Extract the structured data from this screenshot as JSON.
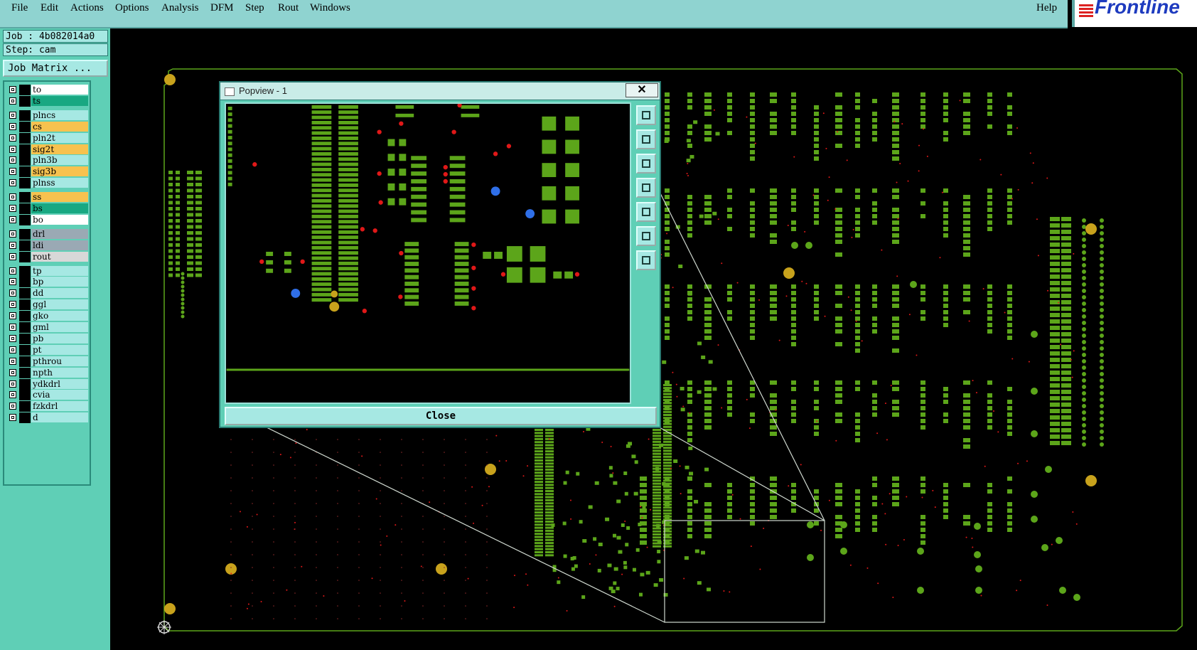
{
  "menu": {
    "items": [
      "File",
      "Edit",
      "Actions",
      "Options",
      "Analysis",
      "DFM",
      "Step",
      "Rout",
      "Windows"
    ],
    "help": "Help"
  },
  "logo": {
    "text": "Frontline"
  },
  "job": {
    "job_line": "Job : 4b082014a0",
    "step_line": "Step: cam",
    "matrix_button": "Job Matrix ..."
  },
  "layers": [
    {
      "name": "to",
      "color": "#ffffff"
    },
    {
      "name": "ts",
      "color": "#18a882"
    },
    {
      "name": "plncs",
      "color": "#a6e8e3"
    },
    {
      "name": "cs",
      "color": "#f7c24f"
    },
    {
      "name": "pln2t",
      "color": "#a6e8e3"
    },
    {
      "name": "sig2t",
      "color": "#f7c24f"
    },
    {
      "name": "pln3b",
      "color": "#a6e8e3"
    },
    {
      "name": "sig3b",
      "color": "#f7c24f"
    },
    {
      "name": "plnss",
      "color": "#a6e8e3"
    },
    {
      "name": "ss",
      "color": "#f7c24f"
    },
    {
      "name": "bs",
      "color": "#18a882"
    },
    {
      "name": "bo",
      "color": "#ffffff"
    },
    {
      "name": "drl",
      "color": "#9aa9b4"
    },
    {
      "name": "ldi",
      "color": "#9aa9b4"
    },
    {
      "name": "rout",
      "color": "#d8d8d8"
    },
    {
      "name": "tp",
      "color": "#a6e8e3"
    },
    {
      "name": "bp",
      "color": "#a6e8e3"
    },
    {
      "name": "dd",
      "color": "#a6e8e3"
    },
    {
      "name": "ggl",
      "color": "#a6e8e3"
    },
    {
      "name": "gko",
      "color": "#a6e8e3"
    },
    {
      "name": "gml",
      "color": "#a6e8e3"
    },
    {
      "name": "pb",
      "color": "#a6e8e3"
    },
    {
      "name": "pt",
      "color": "#a6e8e3"
    },
    {
      "name": "pthrou",
      "color": "#a6e8e3"
    },
    {
      "name": "npth",
      "color": "#a6e8e3"
    },
    {
      "name": "ydkdrl",
      "color": "#a6e8e3"
    },
    {
      "name": "cvia",
      "color": "#a6e8e3"
    },
    {
      "name": "fzkdrl",
      "color": "#a6e8e3"
    },
    {
      "name": "d",
      "color": "#a6e8e3"
    }
  ],
  "popview": {
    "title": "Popview - 1",
    "close_x": "✕",
    "close_button": "Close"
  },
  "colors": {
    "pad": "#5ca51a",
    "outline": "#8fd46a",
    "hole": "#c8a21c",
    "marker_red": "#e01818",
    "marker_blue": "#2f6fe8",
    "panel": "#5fcfb6"
  }
}
